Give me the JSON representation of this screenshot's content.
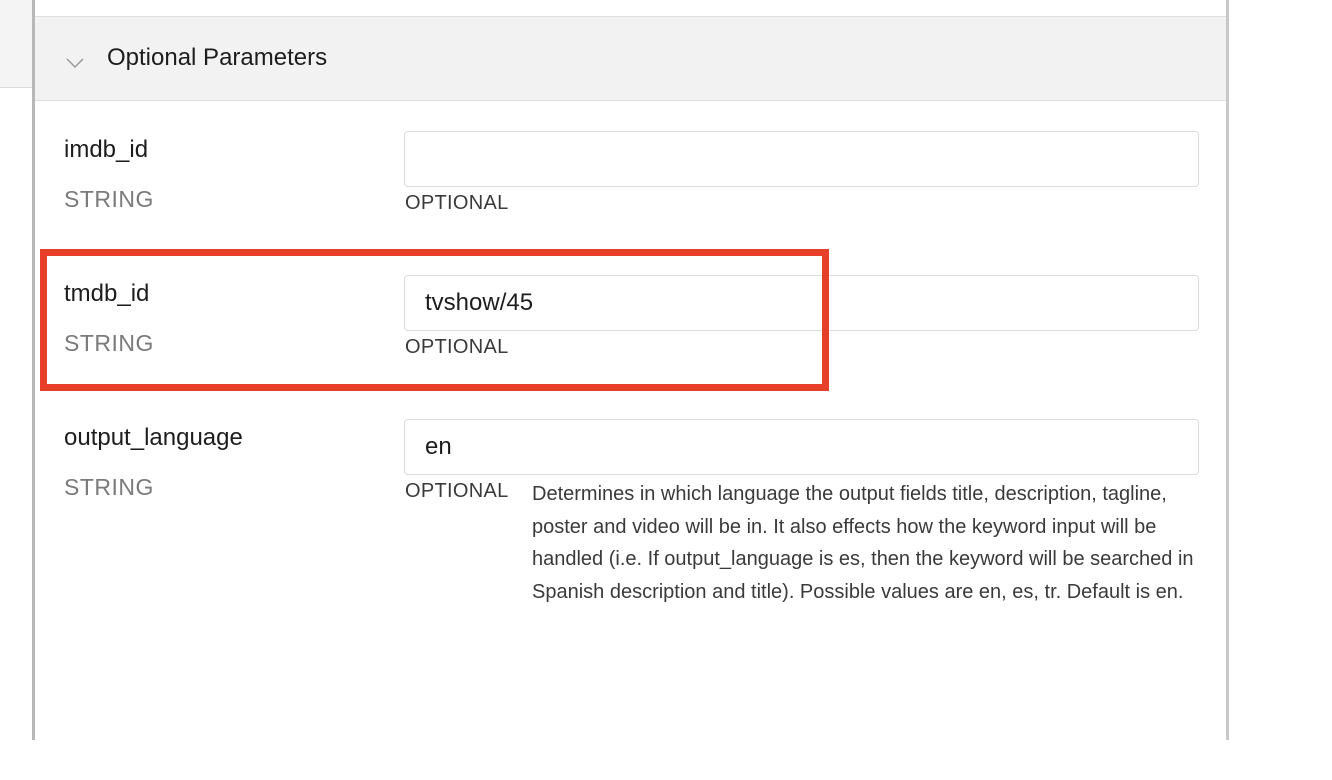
{
  "section": {
    "title": "Optional Parameters",
    "chevron_icon": "chevron-down-icon"
  },
  "params": [
    {
      "name": "imdb_id",
      "type": "STRING",
      "value": "",
      "requirement": "OPTIONAL"
    },
    {
      "name": "tmdb_id",
      "type": "STRING",
      "value": "tvshow/45",
      "requirement": "OPTIONAL"
    },
    {
      "name": "output_language",
      "type": "STRING",
      "value": "en",
      "requirement": "OPTIONAL",
      "description": "Determines in which language the output fields title, description, tagline, poster and video will be in. It also effects how the keyword input will be handled (i.e. If output_language is es, then the keyword will be searched in Spanish description and title). Possible values are en, es, tr. Default is en."
    }
  ],
  "colors": {
    "highlight": "#e5412a",
    "header_bg": "#f2f2f2",
    "type_text": "#7a7a7a"
  }
}
